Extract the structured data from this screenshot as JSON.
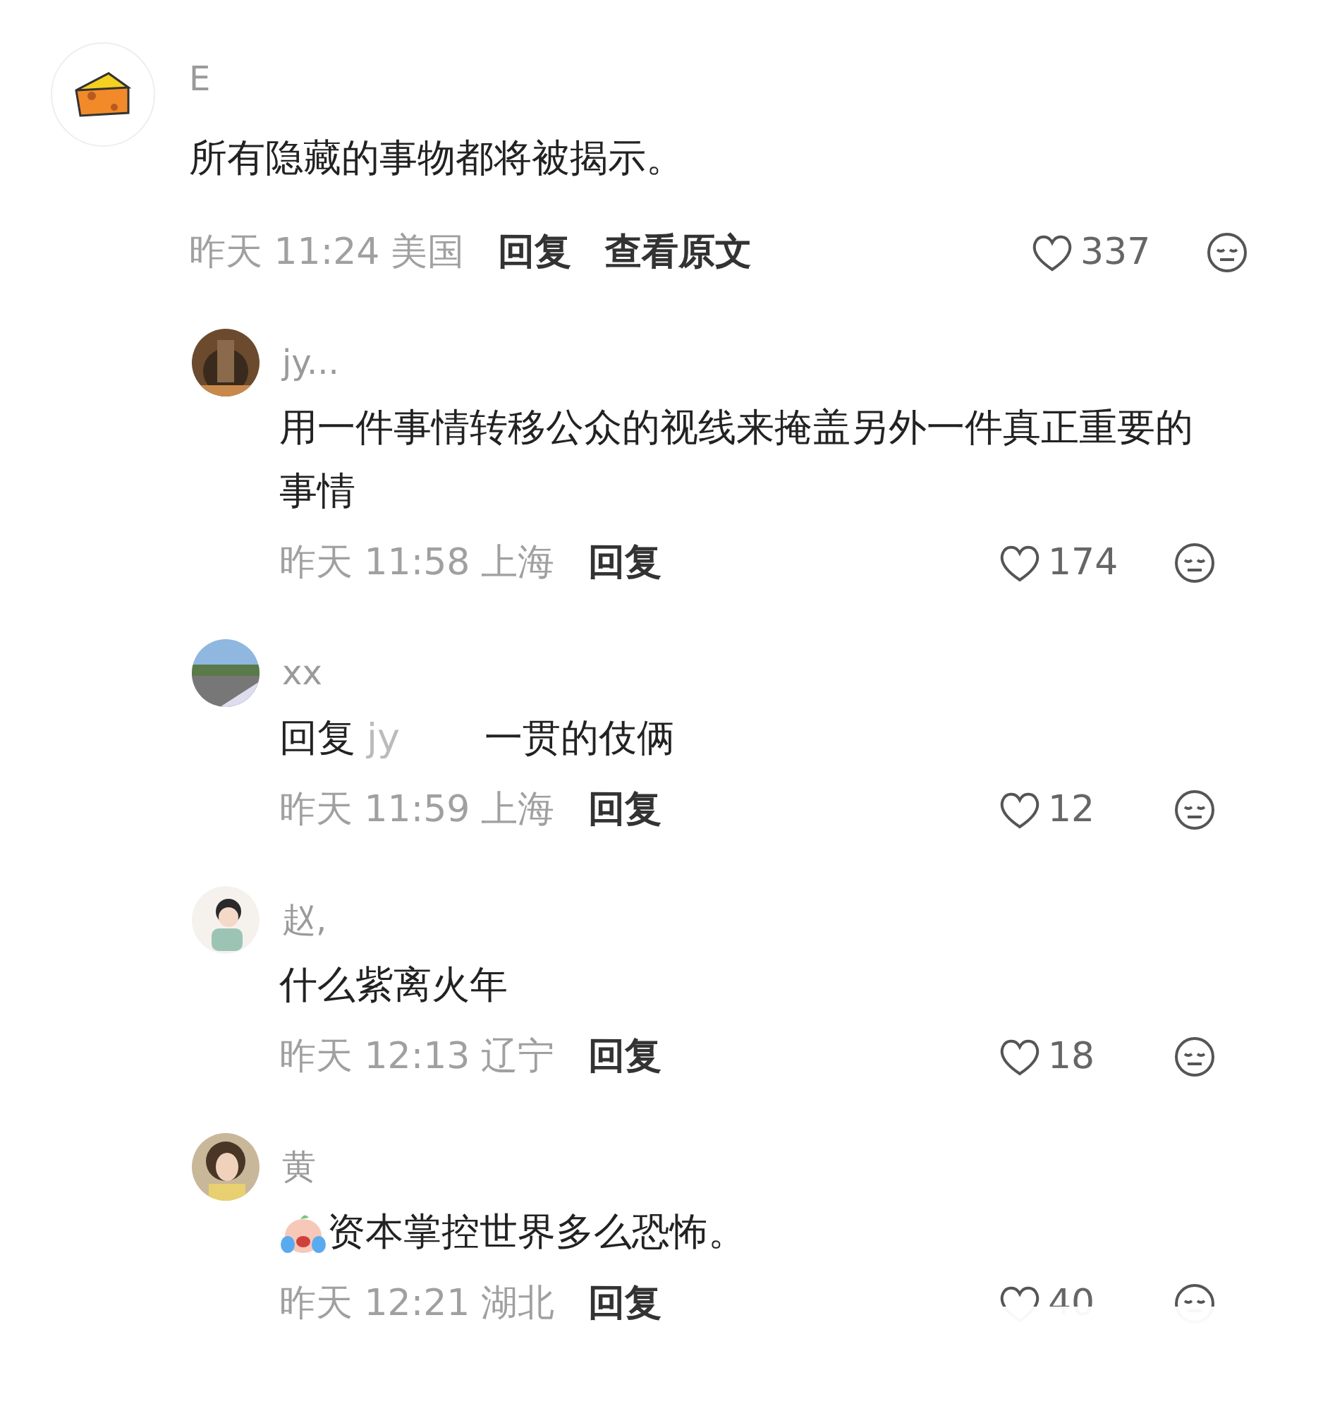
{
  "comment": {
    "user": "E",
    "text": "所有隐藏的事物都将被揭示。",
    "time": "昨天 11:24",
    "location": "美国",
    "actions": [
      "回复",
      "查看原文"
    ],
    "likes": "337",
    "replies": [
      {
        "user": "jy...",
        "text": "用一件事情转移公众的视线来掩盖另外一件真正重要的事情",
        "time": "昨天 11:58",
        "location": "上海",
        "actions": [
          "回复"
        ],
        "likes": "174"
      },
      {
        "user": "xx",
        "reply_prefix": "回复",
        "reply_to": "jy",
        "text": "一贯的伎俩",
        "time": "昨天 11:59",
        "location": "上海",
        "actions": [
          "回复"
        ],
        "likes": "12"
      },
      {
        "user": "赵,",
        "text": "什么紫离火年",
        "time": "昨天 12:13",
        "location": "辽宁",
        "actions": [
          "回复"
        ],
        "likes": "18"
      },
      {
        "user": "黄",
        "crying_emoji": true,
        "text": "资本掌控世界多么恐怖。",
        "time": "昨天 12:21",
        "location": "湖北",
        "actions": [
          "回复"
        ],
        "likes": "40",
        "faded": true
      }
    ]
  }
}
